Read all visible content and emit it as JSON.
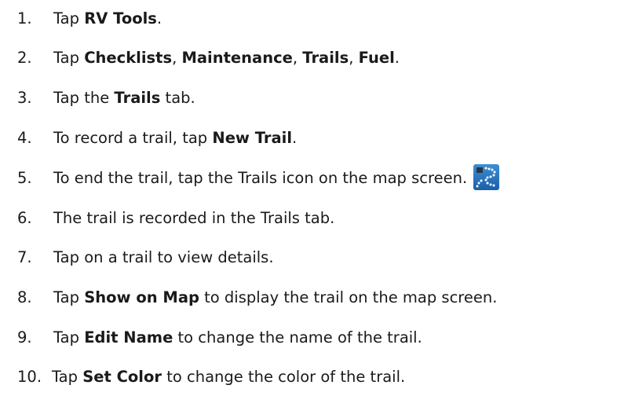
{
  "steps": [
    {
      "num": "1.",
      "parts": [
        {
          "t": "Tap "
        },
        {
          "t": "RV Tools",
          "b": true
        },
        {
          "t": "."
        }
      ]
    },
    {
      "num": "2.",
      "parts": [
        {
          "t": "Tap "
        },
        {
          "t": "Checklists",
          "b": true
        },
        {
          "t": ", "
        },
        {
          "t": "Maintenance",
          "b": true
        },
        {
          "t": ", "
        },
        {
          "t": "Trails",
          "b": true
        },
        {
          "t": ", "
        },
        {
          "t": "Fuel",
          "b": true
        },
        {
          "t": "."
        }
      ]
    },
    {
      "num": "3.",
      "parts": [
        {
          "t": "Tap the "
        },
        {
          "t": "Trails",
          "b": true
        },
        {
          "t": " tab."
        }
      ]
    },
    {
      "num": "4.",
      "parts": [
        {
          "t": "To record a trail, tap "
        },
        {
          "t": "New Trail",
          "b": true
        },
        {
          "t": "."
        }
      ]
    },
    {
      "num": "5.",
      "parts": [
        {
          "t": "To end the trail, tap the Trails icon on the map screen."
        }
      ],
      "icon": "trails-icon"
    },
    {
      "num": "6.",
      "parts": [
        {
          "t": "The trail is recorded in the Trails tab."
        }
      ]
    },
    {
      "num": "7.",
      "parts": [
        {
          "t": "Tap on a trail to view details."
        }
      ]
    },
    {
      "num": "8.",
      "parts": [
        {
          "t": "Tap "
        },
        {
          "t": "Show on Map",
          "b": true
        },
        {
          "t": " to display the trail on the map screen."
        }
      ]
    },
    {
      "num": "9.",
      "parts": [
        {
          "t": "Tap "
        },
        {
          "t": "Edit Name",
          "b": true
        },
        {
          "t": " to change the name of the trail."
        }
      ]
    },
    {
      "num": "10.",
      "parts": [
        {
          "t": "Tap "
        },
        {
          "t": "Set Color",
          "b": true
        },
        {
          "t": " to change the color of the trail."
        }
      ]
    }
  ],
  "colors": {
    "text": "#1a1a1a",
    "icon_bg_top": "#3a8fd6",
    "icon_bg_bottom": "#1b5fa8",
    "icon_dots": "#ffffff"
  }
}
